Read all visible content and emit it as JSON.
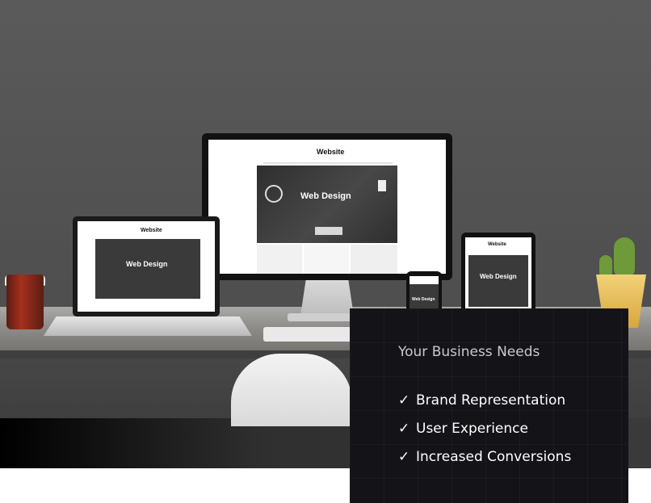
{
  "devices": {
    "site_title": "Website",
    "hero_title": "Web Design"
  },
  "card": {
    "heading": "Your Business Needs",
    "check_glyph": "✓",
    "items": [
      {
        "label": "Brand Representation"
      },
      {
        "label": "User Experience"
      },
      {
        "label": "Increased Conversions"
      }
    ]
  },
  "colors": {
    "card_bg": "#141318",
    "wall": "#505050",
    "desk": "#9a9996"
  }
}
